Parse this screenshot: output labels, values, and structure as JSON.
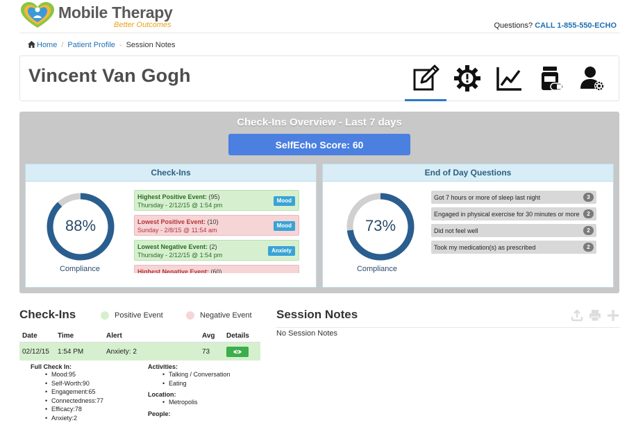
{
  "header": {
    "brand_title": "Mobile Therapy",
    "brand_subtitle": "Better Outcomes",
    "questions_label": "Questions?",
    "call_label": "CALL 1-855-550-ECHO"
  },
  "breadcrumb": {
    "home": "Home",
    "patient_profile": "Patient Profile",
    "current": "Session Notes"
  },
  "patient": {
    "name": "Vincent Van Gogh",
    "nav": [
      {
        "name": "notes-icon",
        "active": true
      },
      {
        "name": "alert-gear-icon",
        "active": false
      },
      {
        "name": "chart-icon",
        "active": false
      },
      {
        "name": "medication-icon",
        "active": false
      },
      {
        "name": "user-settings-icon",
        "active": false
      }
    ]
  },
  "overview": {
    "title": "Check-Ins Overview - Last 7 days",
    "score_label": "SelfEcho Score: 60",
    "checkins": {
      "heading": "Check-Ins",
      "compliance_value": 0.88,
      "compliance_text": "88%",
      "compliance_label": "Compliance",
      "events": [
        {
          "title": "Highest Positive Event:",
          "count": "(95)",
          "date": "Thursday - 2/12/15 @ 1:54 pm",
          "badge": "Mood",
          "kind": "pos"
        },
        {
          "title": "Lowest Positive Event:",
          "count": "(10)",
          "date": "Sunday - 2/8/15 @ 11:54 am",
          "badge": "Mood",
          "kind": "neg"
        },
        {
          "title": "Lowest Negative Event:",
          "count": "(2)",
          "date": "Thursday - 2/12/15 @ 1:54 pm",
          "badge": "Anxiety",
          "kind": "pos"
        },
        {
          "title": "Highest Negative Event:",
          "count": "(60)",
          "date": "",
          "badge": "",
          "kind": "neg"
        }
      ]
    },
    "eod": {
      "heading": "End of Day Questions",
      "compliance_value": 0.73,
      "compliance_text": "73%",
      "compliance_label": "Compliance",
      "items": [
        {
          "text": "Got 7 hours or more of sleep last night",
          "count": "3"
        },
        {
          "text": "Engaged in physical exercise for 30 minutes or more",
          "count": "2"
        },
        {
          "text": "Did not feel well",
          "count": "2"
        },
        {
          "text": "Took my medication(s) as prescribed",
          "count": "2"
        }
      ]
    }
  },
  "checkins_table": {
    "title": "Check-Ins",
    "legend_positive": "Positive Event",
    "legend_negative": "Negative Event",
    "columns": {
      "date": "Date",
      "time": "Time",
      "alert": "Alert",
      "avg": "Avg",
      "details": "Details"
    },
    "rows": [
      {
        "date": "02/12/15",
        "time": "1:54 PM",
        "alert": "Anxiety: 2",
        "avg": "73"
      }
    ],
    "detail": {
      "full_label": "Full Check In:",
      "full_items": [
        "Mood:95",
        "Self-Worth:90",
        "Engagement:65",
        "Connectedness:77",
        "Efficacy:78",
        "Anxiety:2"
      ],
      "activities_label": "Activities:",
      "activities": [
        "Talking / Conversation",
        "Eating"
      ],
      "location_label": "Location:",
      "locations": [
        "Metropolis"
      ],
      "people_label": "People:"
    }
  },
  "session_notes": {
    "title": "Session Notes",
    "empty_text": "No Session Notes"
  },
  "colors": {
    "accent": "#2a78c7",
    "score_button": "#4b7fe0",
    "donut_fill": "#2a5e8e",
    "donut_track": "#d0d0d0",
    "positive": "#d6f0cf",
    "negative": "#f6d5d7"
  }
}
